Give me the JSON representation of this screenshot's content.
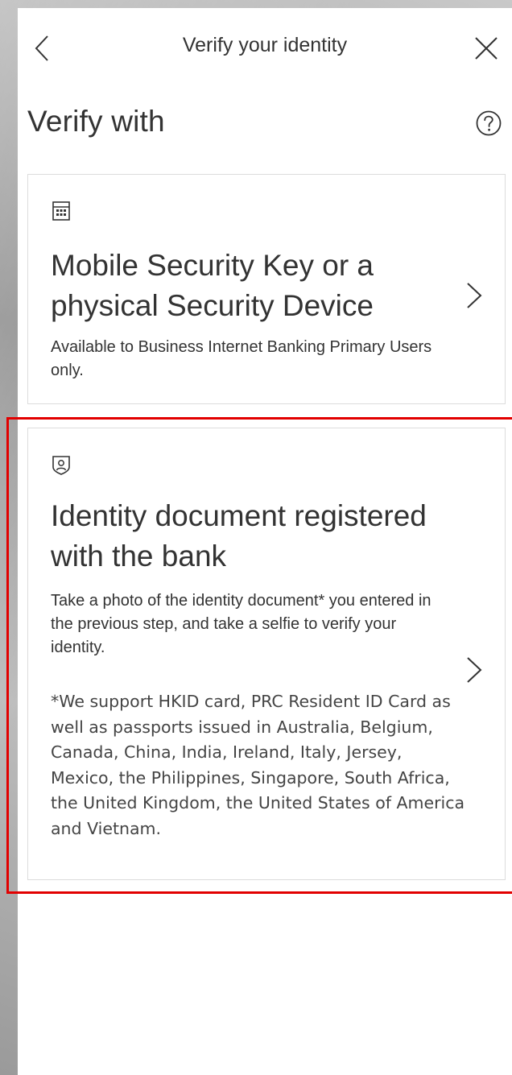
{
  "header": {
    "title": "Verify your identity",
    "back_icon": "chevron-left-icon",
    "close_icon": "close-icon"
  },
  "section": {
    "heading": "Verify with",
    "help_icon": "question-circle-icon"
  },
  "options": [
    {
      "icon": "calculator-icon",
      "title": "Mobile Security Key or a physical Security Device",
      "description": "Available to Business Internet Banking Primary Users only."
    },
    {
      "icon": "id-badge-icon",
      "title": "Identity document registered with the bank",
      "description": "Take a photo of the identity document* you entered in the previous step, and take a selfie to verify your identity.",
      "note": "*We support HKID card, PRC Resident ID Card as well as passports issued in Australia, Belgium, Canada, China, India, Ireland, Italy, Jersey, Mexico, the Philippines, Singapore, South Africa, the United Kingdom, the United States of America and Vietnam.",
      "highlighted": true
    }
  ],
  "colors": {
    "text": "#333333",
    "card_border": "#dcdcdc",
    "highlight": "#e20000",
    "background": "#ffffff"
  }
}
